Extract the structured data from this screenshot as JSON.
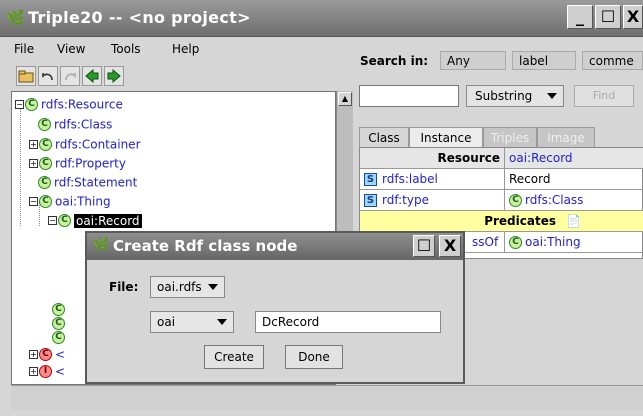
{
  "window": {
    "title": "Triple20 -- <no project>"
  },
  "menu": [
    {
      "label": "File",
      "u": "F"
    },
    {
      "label": "View",
      "u": "V"
    },
    {
      "label": "Tools",
      "u": "T"
    },
    {
      "label": "Help",
      "u": "H"
    }
  ],
  "tree": [
    {
      "label": "rdfs:Resource",
      "type": "class"
    },
    {
      "label": "rdfs:Class",
      "type": "class"
    },
    {
      "label": "rdfs:Container",
      "type": "class"
    },
    {
      "label": "rdf:Property",
      "type": "class"
    },
    {
      "label": "rdf:Statement",
      "type": "class"
    },
    {
      "label": "oai:Thing",
      "type": "class"
    },
    {
      "label": "oai:Record",
      "type": "class",
      "selected": true
    },
    {
      "label": "<",
      "type": "class-red"
    },
    {
      "label": "<",
      "type": "individual"
    }
  ],
  "search": {
    "label": "Search in:",
    "scopes": [
      "Any",
      "label",
      "comme"
    ],
    "match_mode": "Substring",
    "find_button": "Find"
  },
  "tabs": [
    "Class",
    "Instance",
    "Triples",
    "Image"
  ],
  "details": {
    "header_left": "Resource",
    "header_right": "oai:Record",
    "rows": [
      {
        "badge": "S",
        "prop": "rdfs:label",
        "value": "Record"
      },
      {
        "badge": "S",
        "prop": "rdf:type",
        "value": "rdfs:Class",
        "value_badge": "C"
      }
    ],
    "predicates_label": "Predicates",
    "predicate_row": {
      "prop": "ssOf",
      "value": "oai:Thing"
    }
  },
  "dialog": {
    "title": "Create Rdf class node",
    "file_label": "File:",
    "file_value": "oai.rdfs",
    "namespace": "oai",
    "name_value": "DcRecord",
    "create_label": "Create",
    "done_label": "Done"
  }
}
